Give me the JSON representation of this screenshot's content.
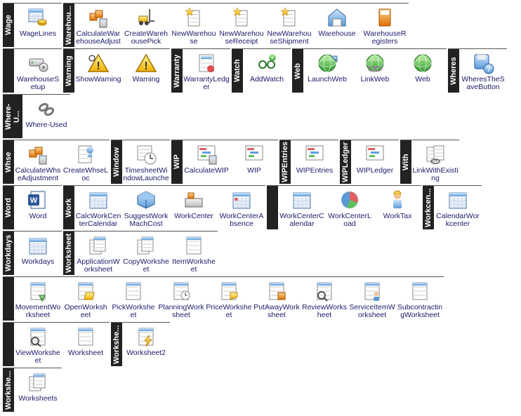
{
  "groups": [
    {
      "label": "Wage",
      "items": [
        {
          "name": "WageLines",
          "icon": "calendar-coins"
        }
      ]
    },
    {
      "label": "Warehou...",
      "items": [
        {
          "name": "CalculateWarehouseAdjustment",
          "icon": "boxes-calc"
        },
        {
          "name": "CreateWarehousePick",
          "icon": "forklift"
        },
        {
          "name": "NewWarehouse",
          "icon": "doc-star"
        },
        {
          "name": "NewWarehouseReceipt",
          "icon": "doc-star"
        },
        {
          "name": "NewWarehouseShipment",
          "icon": "doc-star"
        },
        {
          "name": "Warehouse",
          "icon": "warehouse"
        },
        {
          "name": "WarehouseRegisters",
          "icon": "book"
        }
      ]
    },
    {
      "label": "",
      "items": [
        {
          "name": "WarehouseSetup",
          "icon": "server-gear"
        }
      ]
    },
    {
      "label": "Warning",
      "items": [
        {
          "name": "ShowWarning",
          "icon": "warning-find"
        },
        {
          "name": "Warning",
          "icon": "warning"
        }
      ]
    },
    {
      "label": "Warranty",
      "items": [
        {
          "name": "WarrantyLedger",
          "icon": "ledger"
        }
      ]
    },
    {
      "label": "Watch",
      "items": [
        {
          "name": "AddWatch",
          "icon": "glasses-plus"
        }
      ]
    },
    {
      "label": "Web",
      "items": [
        {
          "name": "LaunchWeb",
          "icon": "globe-arrow"
        },
        {
          "name": "LinkWeb",
          "icon": "globe-link"
        },
        {
          "name": "Web",
          "icon": "globe"
        }
      ]
    },
    {
      "label": "Wheres",
      "items": [
        {
          "name": "WheresTheSaveButton",
          "icon": "disk-question"
        }
      ]
    },
    {
      "label": "Where-U...",
      "items": [
        {
          "name": "Where-Used",
          "icon": "link-chain"
        }
      ]
    },
    {
      "label": "Whse",
      "items": [
        {
          "name": "CalculateWhseAdjustment",
          "icon": "boxes-calc"
        },
        {
          "name": "CreateWhseLoc",
          "icon": "location-doc"
        }
      ]
    },
    {
      "label": "Window",
      "items": [
        {
          "name": "TimesheetWindowLauncher",
          "icon": "timesheet"
        }
      ]
    },
    {
      "label": "WIP",
      "items": [
        {
          "name": "CalculateWIP",
          "icon": "gantt-calc"
        },
        {
          "name": "WIP",
          "icon": "gantt"
        }
      ]
    },
    {
      "label": "WIPEntries",
      "items": [
        {
          "name": "WIPEntries",
          "icon": "gantt-entries"
        }
      ]
    },
    {
      "label": "WIPLedger",
      "items": [
        {
          "name": "WIPLedger",
          "icon": "gantt-ledger"
        }
      ]
    },
    {
      "label": "With",
      "items": [
        {
          "name": "LinkWithExisting",
          "icon": "docs-link"
        }
      ]
    },
    {
      "label": "Word",
      "items": [
        {
          "name": "Word",
          "icon": "word"
        }
      ]
    },
    {
      "label": "Work",
      "items": [
        {
          "name": "CalcWorkCenterCalendar",
          "icon": "calendar-calc"
        },
        {
          "name": "SuggestWorkMachCost",
          "icon": "cube"
        },
        {
          "name": "WorkCenter",
          "icon": "workcenter"
        },
        {
          "name": "WorkCenterAbsence",
          "icon": "calendar-red"
        }
      ]
    },
    {
      "label": "",
      "items": [
        {
          "name": "WorkCenterCalendar",
          "icon": "calendar"
        },
        {
          "name": "WorkCenterLoad",
          "icon": "pie-chart"
        },
        {
          "name": "WorkTax",
          "icon": "worker"
        }
      ]
    },
    {
      "label": "Workcen...",
      "items": [
        {
          "name": "CalendarWorkcenter",
          "icon": "calendar-center"
        }
      ]
    },
    {
      "label": "Workdays",
      "items": [
        {
          "name": "Workdays",
          "icon": "calendar-days"
        }
      ]
    },
    {
      "label": "Worksheet",
      "items": [
        {
          "name": "ApplicationWorksheet",
          "icon": "worksheets"
        },
        {
          "name": "CopyWorksheet",
          "icon": "worksheets-copy"
        },
        {
          "name": "ItemWorksheet",
          "icon": "worksheet"
        }
      ]
    },
    {
      "label": "",
      "items": [
        {
          "name": "MovementWorksheet",
          "icon": "worksheet-arrow"
        },
        {
          "name": "OpenWorksheet",
          "icon": "worksheet-open"
        },
        {
          "name": "PickWorksheet",
          "icon": "worksheet"
        },
        {
          "name": "PlanningWorksheet",
          "icon": "worksheet-clock"
        },
        {
          "name": "PriceWorksheet",
          "icon": "worksheet-tag"
        },
        {
          "name": "PutAwayWorksheet",
          "icon": "worksheet-box"
        },
        {
          "name": "ReviewWorksheet",
          "icon": "worksheet-magnify"
        },
        {
          "name": "ServiceItemWorksheet",
          "icon": "worksheet-person"
        },
        {
          "name": "SubcontractingWorksheet",
          "icon": "worksheet"
        }
      ]
    },
    {
      "label": "",
      "items": [
        {
          "name": "ViewWorksheet",
          "icon": "worksheet-magnify"
        },
        {
          "name": "Worksheet",
          "icon": "worksheet"
        }
      ]
    },
    {
      "label": "Workshe...",
      "items": [
        {
          "name": "Worksheet2",
          "icon": "worksheet-bolt"
        }
      ]
    },
    {
      "label": "Workshe...",
      "items": [
        {
          "name": "Worksheets",
          "icon": "worksheets"
        }
      ]
    }
  ],
  "row_breaks": [
    2,
    9,
    15,
    21,
    22,
    24
  ]
}
